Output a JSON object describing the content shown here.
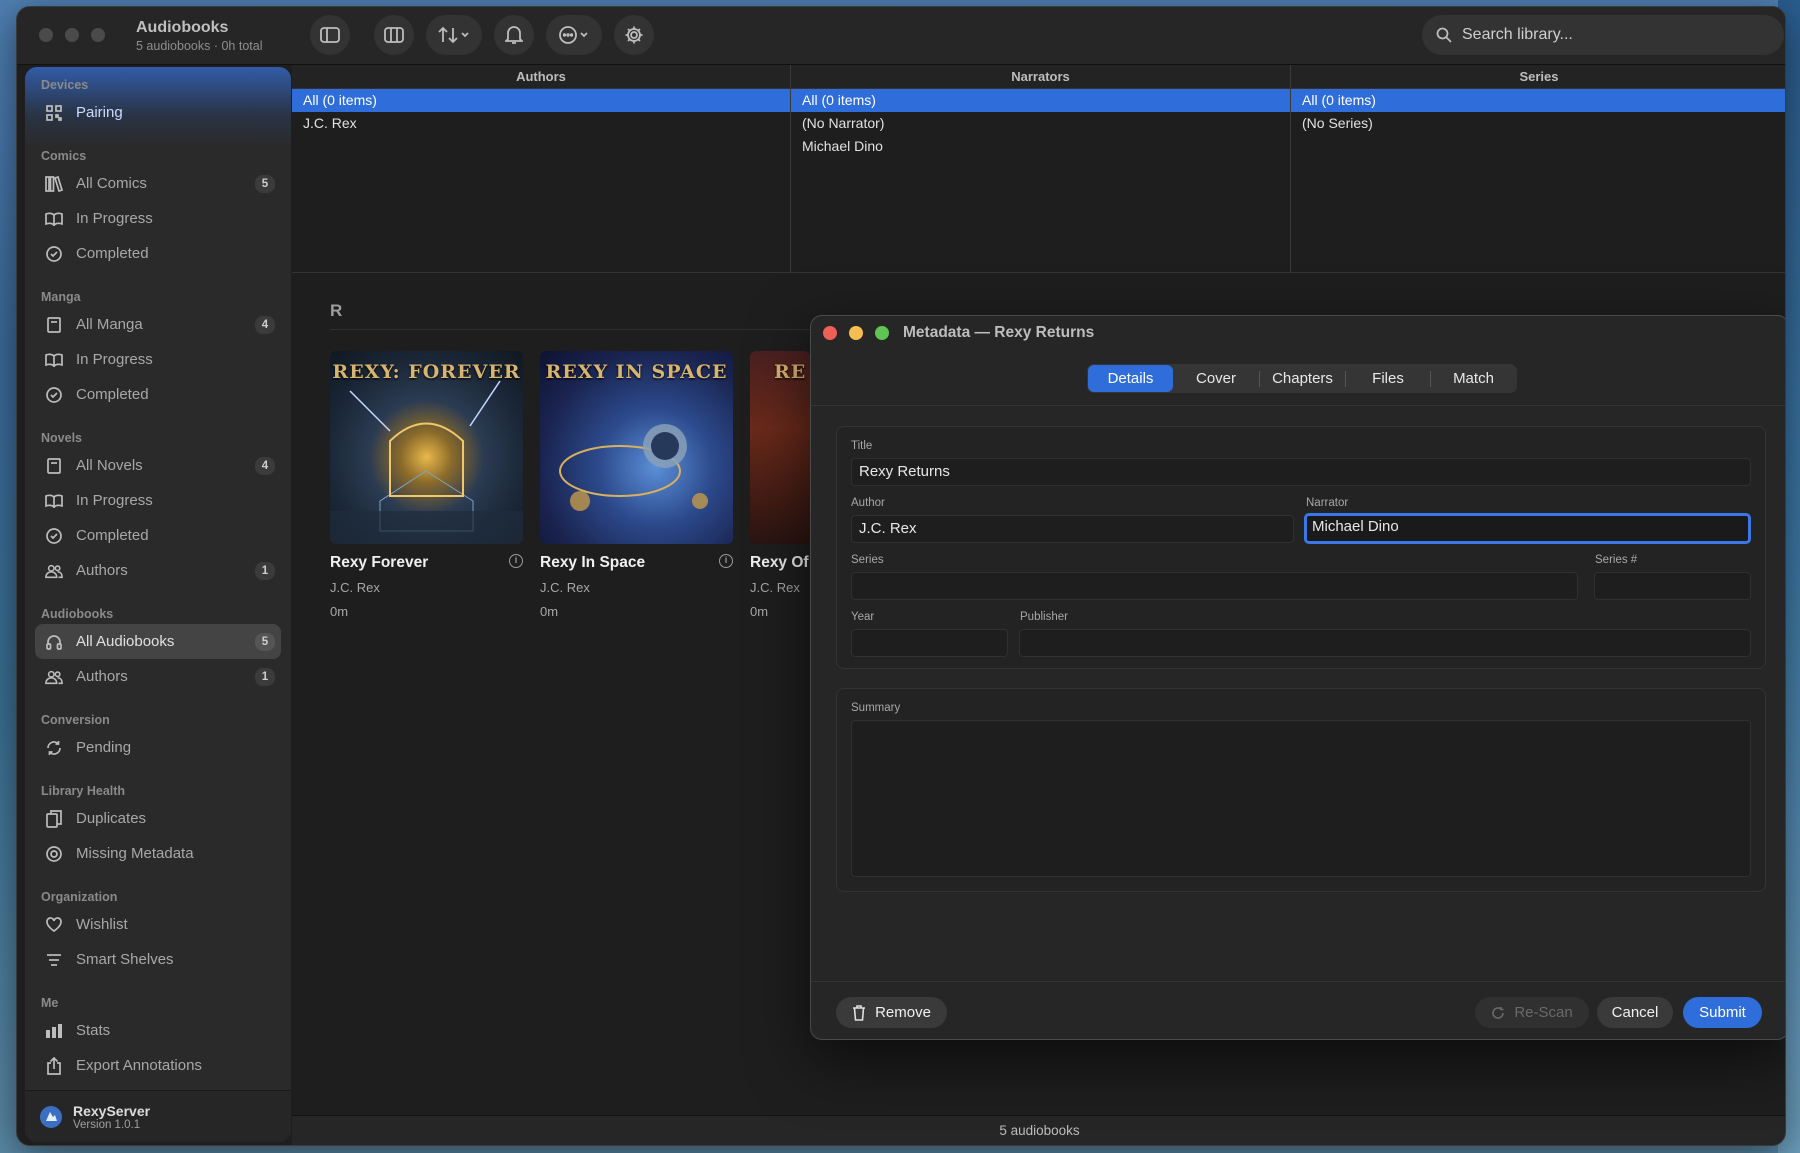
{
  "window": {
    "title": "Audiobooks",
    "subtitle": "5 audiobooks · 0h total"
  },
  "search": {
    "placeholder": "Search library..."
  },
  "sidebar": {
    "sections": [
      {
        "title": "Devices",
        "items": [
          {
            "label": "Pairing",
            "icon": "qr-code-icon"
          }
        ]
      },
      {
        "title": "Comics",
        "items": [
          {
            "label": "All Comics",
            "icon": "library-icon",
            "badge": "5"
          },
          {
            "label": "In Progress",
            "icon": "book-open-icon"
          },
          {
            "label": "Completed",
            "icon": "check-circle-icon"
          }
        ]
      },
      {
        "title": "Manga",
        "items": [
          {
            "label": "All Manga",
            "icon": "book-icon",
            "badge": "4"
          },
          {
            "label": "In Progress",
            "icon": "book-open-icon"
          },
          {
            "label": "Completed",
            "icon": "check-circle-icon"
          }
        ]
      },
      {
        "title": "Novels",
        "items": [
          {
            "label": "All Novels",
            "icon": "book-icon",
            "badge": "4"
          },
          {
            "label": "In Progress",
            "icon": "book-open-icon"
          },
          {
            "label": "Completed",
            "icon": "check-circle-icon"
          },
          {
            "label": "Authors",
            "icon": "people-icon",
            "badge": "1"
          }
        ]
      },
      {
        "title": "Audiobooks",
        "items": [
          {
            "label": "All Audiobooks",
            "icon": "headphones-icon",
            "badge": "5",
            "active": true
          },
          {
            "label": "Authors",
            "icon": "people-icon",
            "badge": "1"
          }
        ]
      },
      {
        "title": "Conversion",
        "items": [
          {
            "label": "Pending",
            "icon": "sync-icon"
          }
        ]
      },
      {
        "title": "Library Health",
        "items": [
          {
            "label": "Duplicates",
            "icon": "duplicate-icon"
          },
          {
            "label": "Missing Metadata",
            "icon": "target-icon"
          }
        ]
      },
      {
        "title": "Organization",
        "items": [
          {
            "label": "Wishlist",
            "icon": "heart-icon"
          },
          {
            "label": "Smart Shelves",
            "icon": "filter-lines-icon"
          }
        ]
      },
      {
        "title": "Me",
        "items": [
          {
            "label": "Stats",
            "icon": "bar-chart-icon"
          },
          {
            "label": "Export Annotations",
            "icon": "share-icon"
          }
        ]
      }
    ],
    "footer": {
      "name": "RexyServer",
      "version": "Version 1.0.1"
    }
  },
  "browser": {
    "columns": [
      {
        "header": "Authors",
        "rows": [
          "All (0 items)",
          "J.C. Rex"
        ]
      },
      {
        "header": "Narrators",
        "rows": [
          "All (0 items)",
          "(No Narrator)",
          "Michael Dino"
        ]
      },
      {
        "header": "Series",
        "rows": [
          "All (0 items)",
          "(No Series)"
        ]
      }
    ]
  },
  "content": {
    "section_letter": "R",
    "books": [
      {
        "title": "Rexy Forever",
        "author": "J.C. Rex",
        "duration": "0m",
        "cover_text": "REXY: FOREVER"
      },
      {
        "title": "Rexy In Space",
        "author": "J.C. Rex",
        "duration": "0m",
        "cover_text": "REXY IN SPACE"
      },
      {
        "title": "Rexy Of",
        "author": "J.C. Rex",
        "duration": "0m",
        "cover_text": "RE"
      }
    ]
  },
  "status_bar": "5 audiobooks",
  "modal": {
    "title": "Metadata — Rexy Returns",
    "tabs": [
      "Details",
      "Cover",
      "Chapters",
      "Files",
      "Match"
    ],
    "active_tab": "Details",
    "fields": {
      "title_label": "Title",
      "title_value": "Rexy Returns",
      "author_label": "Author",
      "author_value": "J.C. Rex",
      "narrator_label": "Narrator",
      "narrator_value": "Michael Dino",
      "series_label": "Series",
      "series_value": "",
      "series_num_label": "Series #",
      "series_num_value": "",
      "year_label": "Year",
      "year_value": "",
      "publisher_label": "Publisher",
      "publisher_value": "",
      "summary_label": "Summary",
      "summary_value": ""
    },
    "buttons": {
      "remove": "Remove",
      "rescan": "Re-Scan",
      "cancel": "Cancel",
      "submit": "Submit"
    }
  },
  "colors": {
    "accent": "#2f6ddb",
    "close": "#ed5f57",
    "minimize": "#f5be4f",
    "zoom": "#5fc454"
  }
}
